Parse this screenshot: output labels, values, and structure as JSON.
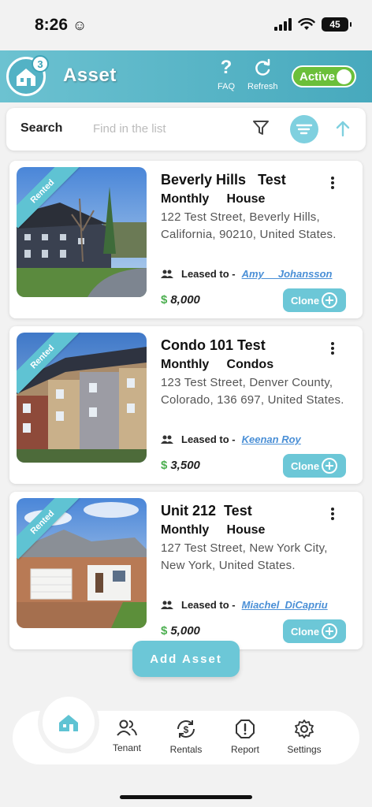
{
  "status_bar": {
    "time": "8:26",
    "battery": "45"
  },
  "header": {
    "badge_count": "3",
    "title": "Asset",
    "faq_label": "FAQ",
    "refresh_label": "Refresh",
    "status_toggle": "Active"
  },
  "search": {
    "label": "Search",
    "placeholder": "Find in the list"
  },
  "assets": [
    {
      "ribbon": "Rented",
      "title": "Beverly Hills   Test",
      "subtitle": "Monthly     House",
      "address": "122 Test Street, Beverly Hills, California, 90210, United States.",
      "leased_label": "Leased to -",
      "tenant": "Amy     Johansson",
      "currency": "$",
      "price": "8,000",
      "clone_label": "Clone"
    },
    {
      "ribbon": "Rented",
      "title": "Condo 101 Test",
      "subtitle": "Monthly     Condos",
      "address": "123 Test Street, Denver County, Colorado, 136 697, United States.",
      "leased_label": "Leased to -",
      "tenant": "Keenan Roy",
      "currency": "$",
      "price": "3,500",
      "clone_label": "Clone"
    },
    {
      "ribbon": "Rented",
      "title": "Unit 212  Test",
      "subtitle": "Monthly     House",
      "address": "127 Test Street, New York City, New York, United States.",
      "leased_label": "Leased to -",
      "tenant": "Miachel  DiCapriu",
      "currency": "$",
      "price": "5,000",
      "clone_label": "Clone"
    }
  ],
  "add_asset_label": "Add Asset",
  "bottom_nav": [
    {
      "label": "Tenant",
      "icon": "tenant-icon"
    },
    {
      "label": "Rentals",
      "icon": "rentals-icon"
    },
    {
      "label": "Report",
      "icon": "report-icon"
    },
    {
      "label": "Settings",
      "icon": "settings-icon"
    }
  ],
  "colors": {
    "accent": "#5fc3d3",
    "header_start": "#6cc2d1",
    "header_end": "#47a9bd",
    "active_green": "#6bbf3a",
    "price_green": "#4caf50",
    "link_blue": "#4a8fd6"
  }
}
